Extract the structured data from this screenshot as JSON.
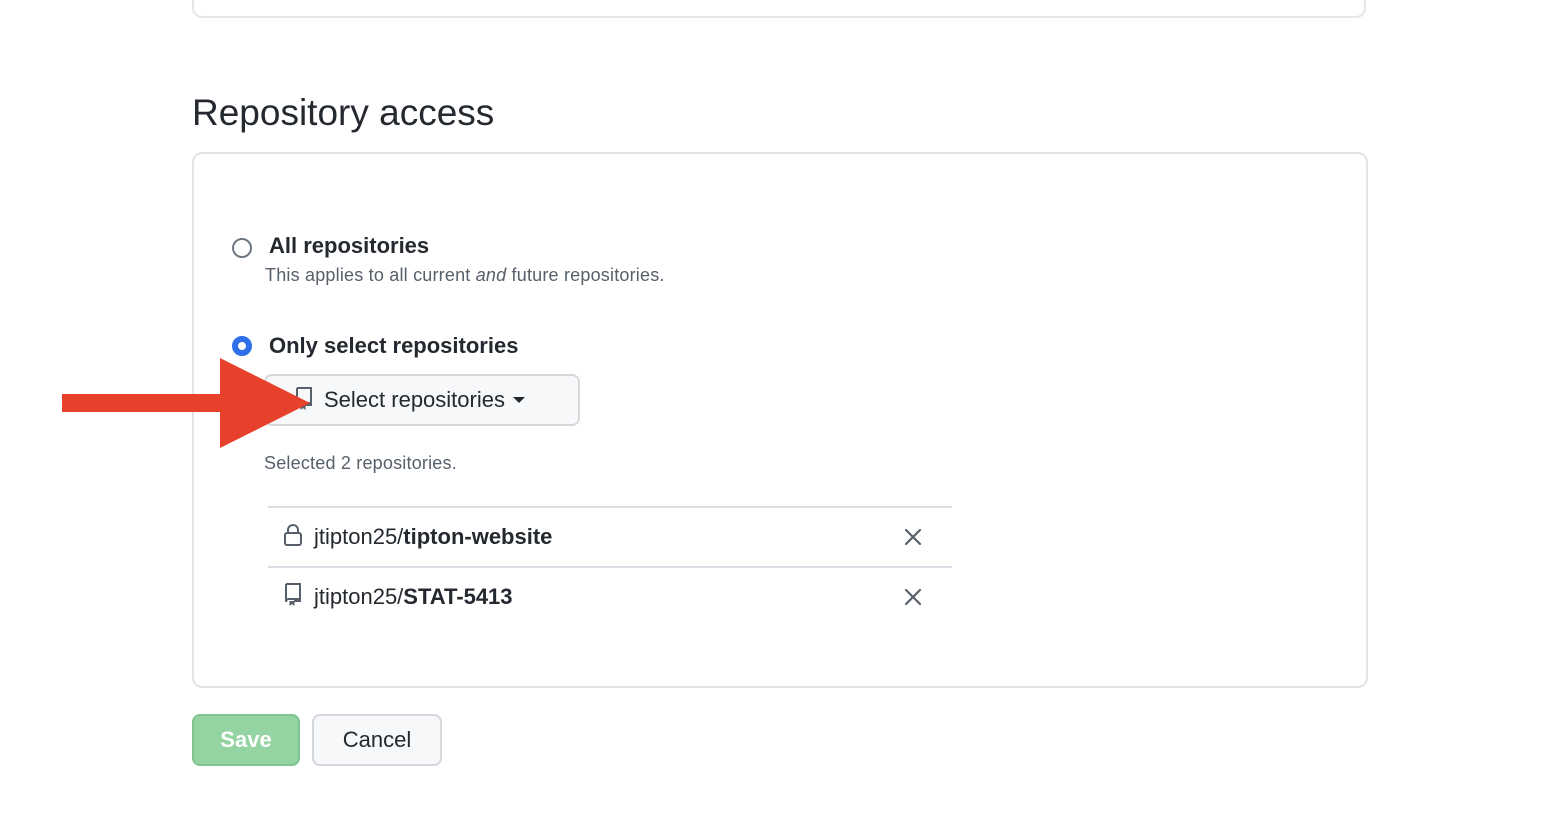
{
  "section": {
    "title": "Repository access"
  },
  "options": {
    "all": {
      "title": "All repositories",
      "desc_before": "This applies to all current ",
      "desc_em": "and",
      "desc_after": " future repositories.",
      "checked": false
    },
    "select": {
      "title": "Only select repositories",
      "checked": true
    }
  },
  "select_button": {
    "label": "Select repositories",
    "icon": "repo-icon"
  },
  "selected_summary": "Selected 2 repositories.",
  "repos": [
    {
      "owner": "jtipton25/",
      "name": "tipton-website",
      "icon": "lock-icon"
    },
    {
      "owner": "jtipton25/",
      "name": "STAT-5413",
      "icon": "repo-icon"
    }
  ],
  "actions": {
    "save_label": "Save",
    "cancel_label": "Cancel"
  },
  "colors": {
    "accent": "#2f6fe8",
    "save_bg": "#94d3a2",
    "annotation_arrow": "#e8412b"
  }
}
